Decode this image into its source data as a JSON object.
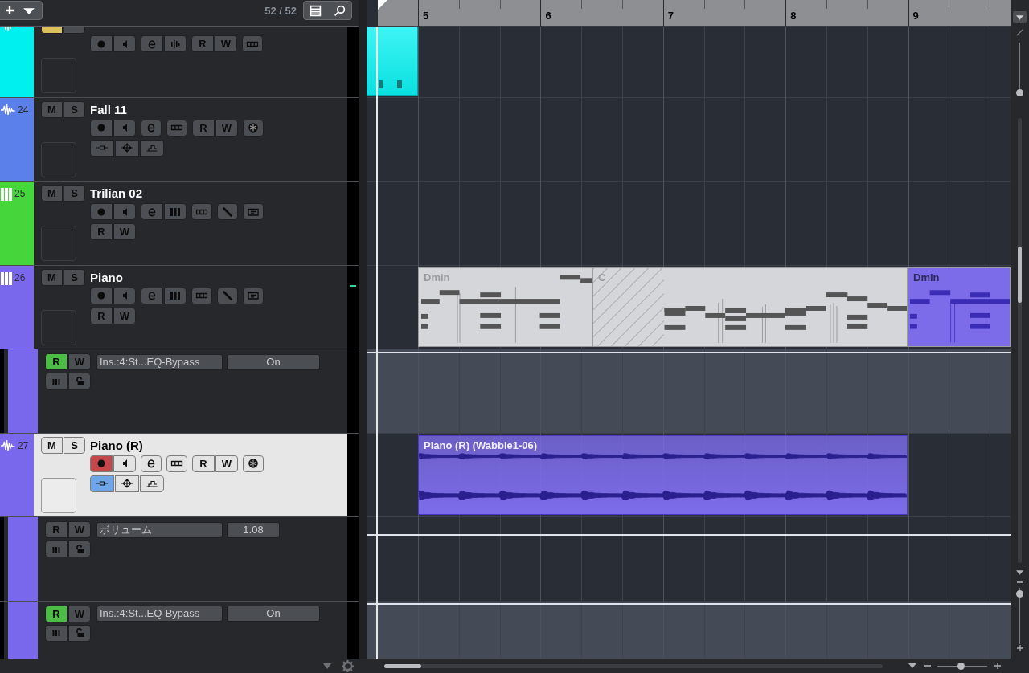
{
  "header": {
    "track_count": "52 / 52"
  },
  "tracks": [
    {
      "kind": "track",
      "strip_icon": {
        "kind": "audio"
      },
      "color": "#00f0f0",
      "selected": false,
      "meter_active": false,
      "mute": {
        "on": true
      },
      "solo": {
        "on": false
      },
      "control_rows": [
        [
          [
            {
              "kind": "record",
              "on": false
            },
            {
              "kind": "monitor",
              "on": false
            }
          ],
          [
            {
              "kind": "edit",
              "on": false
            },
            {
              "kind": "bars",
              "on": false
            }
          ],
          [
            {
              "kind": "read",
              "label": "R",
              "on": false
            },
            {
              "kind": "write",
              "label": "W",
              "on": false
            }
          ],
          [
            {
              "kind": "lanes",
              "on": false
            }
          ]
        ]
      ]
    },
    {
      "kind": "track",
      "strip_icon": {
        "kind": "audio"
      },
      "number": "24",
      "name": "Fall 11",
      "color": "#5b80ea",
      "selected": false,
      "meter_active": false,
      "mute": {
        "label": "M",
        "on": false
      },
      "solo": {
        "label": "S",
        "on": false
      },
      "control_rows": [
        [
          [
            {
              "kind": "record",
              "on": false
            },
            {
              "kind": "monitor",
              "on": false
            }
          ],
          [
            {
              "kind": "edit",
              "on": false
            }
          ],
          [
            {
              "kind": "lanes",
              "on": false
            }
          ],
          [
            {
              "kind": "read",
              "label": "R",
              "on": false
            },
            {
              "kind": "write",
              "label": "W",
              "on": false
            }
          ],
          [
            {
              "kind": "freeze",
              "on": false
            }
          ]
        ],
        [
          [
            {
              "kind": "tool-a",
              "on": false
            },
            {
              "kind": "tool-b",
              "on": false
            },
            {
              "kind": "tool-c",
              "on": false
            }
          ]
        ]
      ]
    },
    {
      "kind": "track",
      "strip_icon": {
        "kind": "instrument"
      },
      "number": "25",
      "name": "Trilian 02",
      "color": "#45d63c",
      "selected": false,
      "meter_active": false,
      "mute": {
        "label": "M",
        "on": false
      },
      "solo": {
        "label": "S",
        "on": false
      },
      "control_rows": [
        [
          [
            {
              "kind": "record",
              "on": false
            },
            {
              "kind": "monitor",
              "on": false
            }
          ],
          [
            {
              "kind": "edit",
              "on": false
            },
            {
              "kind": "keys",
              "on": false
            }
          ],
          [
            {
              "kind": "lanes",
              "on": false
            }
          ],
          [
            {
              "kind": "pencil",
              "on": false
            }
          ],
          [
            {
              "kind": "notepad",
              "on": false
            }
          ]
        ],
        [
          [
            {
              "kind": "read",
              "label": "R",
              "on": false
            },
            {
              "kind": "write",
              "label": "W",
              "on": false
            }
          ]
        ]
      ]
    },
    {
      "kind": "track",
      "strip_icon": {
        "kind": "instrument"
      },
      "number": "26",
      "name": "Piano",
      "color": "#7a68ec",
      "selected": false,
      "meter_active": true,
      "mute": {
        "label": "M",
        "on": false
      },
      "solo": {
        "label": "S",
        "on": false
      },
      "control_rows": [
        [
          [
            {
              "kind": "record",
              "on": false
            },
            {
              "kind": "monitor",
              "on": false
            }
          ],
          [
            {
              "kind": "edit",
              "on": false
            },
            {
              "kind": "keys",
              "on": false
            }
          ],
          [
            {
              "kind": "lanes",
              "on": false
            }
          ],
          [
            {
              "kind": "pencil",
              "on": false
            }
          ],
          [
            {
              "kind": "notepad",
              "on": false
            }
          ]
        ],
        [
          [
            {
              "kind": "read",
              "label": "R",
              "on": false
            },
            {
              "kind": "write",
              "label": "W",
              "on": false
            }
          ]
        ]
      ],
      "parts": [
        {
          "kind": "chord",
          "label": "Dmin",
          "color": "#d4d6d9"
        },
        {
          "kind": "chord",
          "label": "C",
          "color": "#d4d6d9"
        },
        {
          "kind": "chord",
          "label": "Dmin",
          "color": "#7c6cea"
        }
      ]
    },
    {
      "kind": "automation",
      "color": "#7a68ec",
      "read": {
        "label": "R",
        "on": true
      },
      "write": {
        "label": "W",
        "on": false
      },
      "parameter": "Ins.:4:St...EQ-Bypass",
      "value": "On",
      "value_field": {
        "kind": "toggle"
      }
    },
    {
      "kind": "track",
      "strip_icon": {
        "kind": "audio"
      },
      "number": "27",
      "name": "Piano (R)",
      "color": "#7a68ec",
      "selected": true,
      "meter_active": false,
      "mute": {
        "label": "M",
        "on": false
      },
      "solo": {
        "label": "S",
        "on": false
      },
      "control_rows": [
        [
          [
            {
              "kind": "record",
              "on": true
            },
            {
              "kind": "monitor",
              "on": false
            }
          ],
          [
            {
              "kind": "edit",
              "on": false
            }
          ],
          [
            {
              "kind": "lanes",
              "on": false
            }
          ],
          [
            {
              "kind": "read",
              "label": "R",
              "on": false
            },
            {
              "kind": "write",
              "label": "W",
              "on": false
            }
          ],
          [
            {
              "kind": "freeze",
              "on": false
            }
          ]
        ],
        [
          [
            {
              "kind": "tool-a",
              "on": true
            },
            {
              "kind": "tool-b",
              "on": false
            },
            {
              "kind": "tool-c",
              "on": false
            }
          ]
        ]
      ],
      "parts": [
        {
          "kind": "audio",
          "label": "Piano (R) (Wabble1-06)",
          "color": "#7c6cea"
        }
      ]
    },
    {
      "kind": "automation",
      "color": "#7a68ec",
      "read": {
        "label": "R",
        "on": false
      },
      "write": {
        "label": "W",
        "on": false
      },
      "parameter": "ボリューム",
      "value": "1.08",
      "value_field": {
        "kind": "number"
      }
    },
    {
      "kind": "automation",
      "color": "#7a68ec",
      "read": {
        "label": "R",
        "on": true
      },
      "write": {
        "label": "W",
        "on": false
      },
      "parameter": "Ins.:4:St...EQ-Bypass",
      "value": "On",
      "value_field": {
        "kind": "toggle"
      }
    }
  ],
  "ruler": {
    "bars": [
      "5",
      "6",
      "7",
      "8",
      "9"
    ]
  },
  "vertical_zoom": {
    "level": 0.05
  },
  "track_height_zoom": {
    "level": 0.88
  },
  "horizontal_zoom": {
    "level": 0.47
  }
}
